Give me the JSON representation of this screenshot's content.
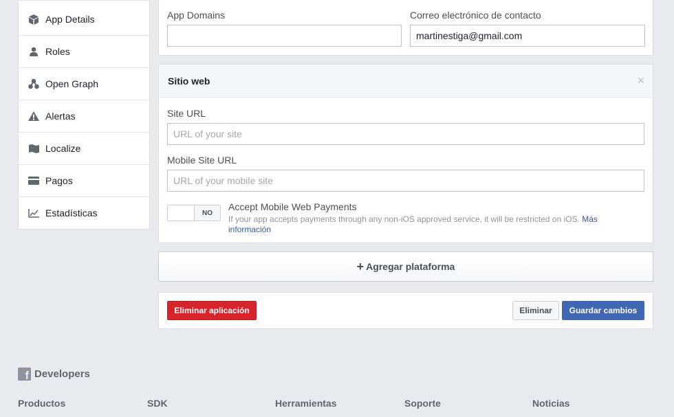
{
  "sidebar": {
    "items": [
      {
        "label": "App Details",
        "icon": "cube-icon"
      },
      {
        "label": "Roles",
        "icon": "person-icon"
      },
      {
        "label": "Open Graph",
        "icon": "graph-icon"
      },
      {
        "label": "Alertas",
        "icon": "warning-icon"
      },
      {
        "label": "Localize",
        "icon": "map-icon"
      },
      {
        "label": "Pagos",
        "icon": "card-icon"
      },
      {
        "label": "Estadísticas",
        "icon": "chart-icon"
      }
    ]
  },
  "basic": {
    "app_domains_label": "App Domains",
    "app_domains_value": "",
    "contact_email_label": "Correo electrónico de contacto",
    "contact_email_value": "martinestiga@gmail.com"
  },
  "website": {
    "title": "Sitio web",
    "close": "×",
    "site_url_label": "Site URL",
    "site_url_placeholder": "URL of your site",
    "mobile_url_label": "Mobile Site URL",
    "mobile_url_placeholder": "URL of your mobile site",
    "toggle_state": "NO",
    "toggle_title": "Accept Mobile Web Payments",
    "toggle_desc": "If your app accepts payments through any non-iOS approved service, it will be restricted on iOS.",
    "toggle_link": "Más información"
  },
  "add_platform": {
    "plus": "+",
    "label": "Agregar plataforma"
  },
  "actions": {
    "delete_app": "Eliminar aplicación",
    "delete": "Eliminar",
    "save": "Guardar cambios"
  },
  "footer": {
    "brand_letter": "f",
    "brand": "Developers",
    "columns": [
      "Productos",
      "SDK",
      "Herramientas",
      "Soporte",
      "Noticias"
    ]
  },
  "colors": {
    "primary": "#4267b2",
    "danger": "#d7232a",
    "link": "#365899",
    "background": "#e9eaed"
  }
}
